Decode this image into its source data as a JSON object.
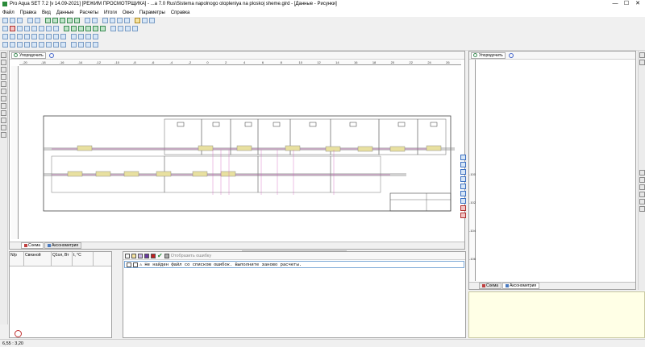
{
  "window": {
    "title": "Pro Aqua SET 7.2  [v 14.09-2021] [РЕЖИМ ПРОСМОТРЩИКА] - ...a 7.0 Rus\\Sistema napolnogo otopleniya na ploskoj sheme.gird - [Данные - Рисунки]",
    "buttons": [
      "—",
      "☐",
      "✕"
    ]
  },
  "menu": [
    "Файл",
    "Правка",
    "Вид",
    "Данные",
    "Расчеты",
    "Итоги",
    "Окно",
    "Параметры",
    "Справка"
  ],
  "main_panel": {
    "sort_button": "Упорядочить",
    "ruler_h": [
      "-20",
      "-18",
      "-16",
      "-14",
      "-12",
      "-10",
      "-8",
      "-6",
      "-4",
      "-2",
      "0",
      "2",
      "4",
      "6",
      "8",
      "10",
      "12",
      "14",
      "16",
      "18",
      "20",
      "22",
      "24",
      "26"
    ],
    "tabs": [
      "Схема",
      "Аксонометрия"
    ]
  },
  "right_panel": {
    "sort_button": "Упорядочить",
    "ruler_v": [
      "-100",
      "-102",
      "-104",
      "-106"
    ],
    "tabs": [
      "Схема",
      "Аксонометрия"
    ]
  },
  "bottom_left": {
    "headers": [
      "N/p",
      "Связной",
      "Q1ол, Вт",
      "t, °C"
    ]
  },
  "messages": {
    "toolbar_label": "Отобразить ошибку",
    "rows": [
      "Не найден файл со списком ошибок. Выполните заново расчеты."
    ]
  },
  "status": {
    "coords": "6,55 : 3,20"
  },
  "colors": {
    "equipment_fill": "#e8e0a0",
    "pipe_pink": "#d060c0",
    "pipe_gray": "#808080",
    "message_border": "#7aa7d6"
  }
}
